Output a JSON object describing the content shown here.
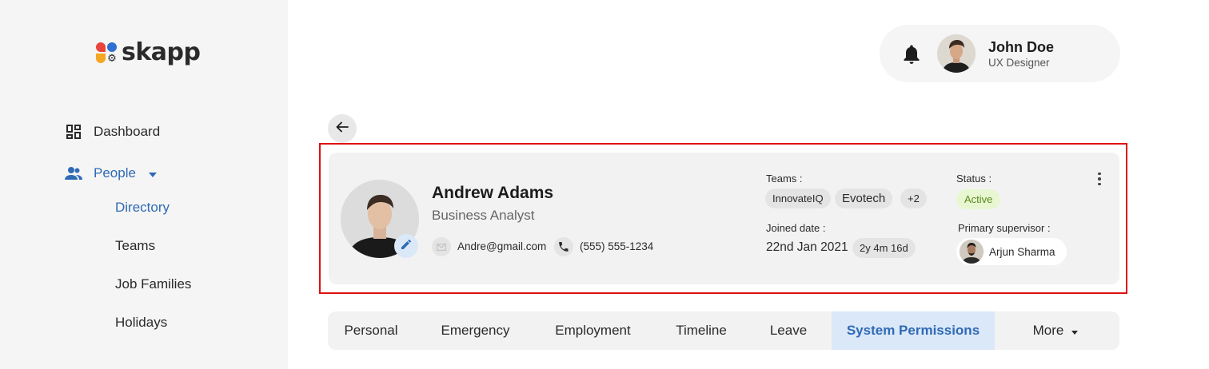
{
  "brand": {
    "name": "skapp"
  },
  "sidebar": {
    "dashboard_label": "Dashboard",
    "people_label": "People",
    "sub_items": [
      {
        "label": "Directory",
        "active": true
      },
      {
        "label": "Teams",
        "active": false
      },
      {
        "label": "Job Families",
        "active": false
      },
      {
        "label": "Holidays",
        "active": false
      }
    ]
  },
  "header": {
    "user_name": "John Doe",
    "user_role": "UX Designer",
    "icons": [
      "bell-icon",
      "avatar"
    ]
  },
  "profile": {
    "name": "Andrew Adams",
    "title": "Business Analyst",
    "email": "Andre@gmail.com",
    "phone": "(555) 555-1234",
    "teams_label": "Teams :",
    "teams": [
      "InnovateIQ",
      "Evotech"
    ],
    "teams_more": "+2",
    "status_label": "Status :",
    "status": "Active",
    "joined_label": "Joined date :",
    "joined_date": "22nd Jan 2021",
    "tenure": "2y 4m 16d",
    "supervisor_label": "Primary supervisor :",
    "supervisor_name": "Arjun Sharma"
  },
  "tabs": [
    {
      "label": "Personal",
      "active": false
    },
    {
      "label": "Emergency",
      "active": false
    },
    {
      "label": "Employment",
      "active": false
    },
    {
      "label": "Timeline",
      "active": false
    },
    {
      "label": "Leave",
      "active": false
    },
    {
      "label": "System Permissions",
      "active": true
    },
    {
      "label": "More",
      "active": false
    }
  ],
  "colors": {
    "accent": "#2f6ab5",
    "status_bg": "#e8f7d2",
    "status_text": "#5a8a1f",
    "highlight_border": "#e01010"
  }
}
